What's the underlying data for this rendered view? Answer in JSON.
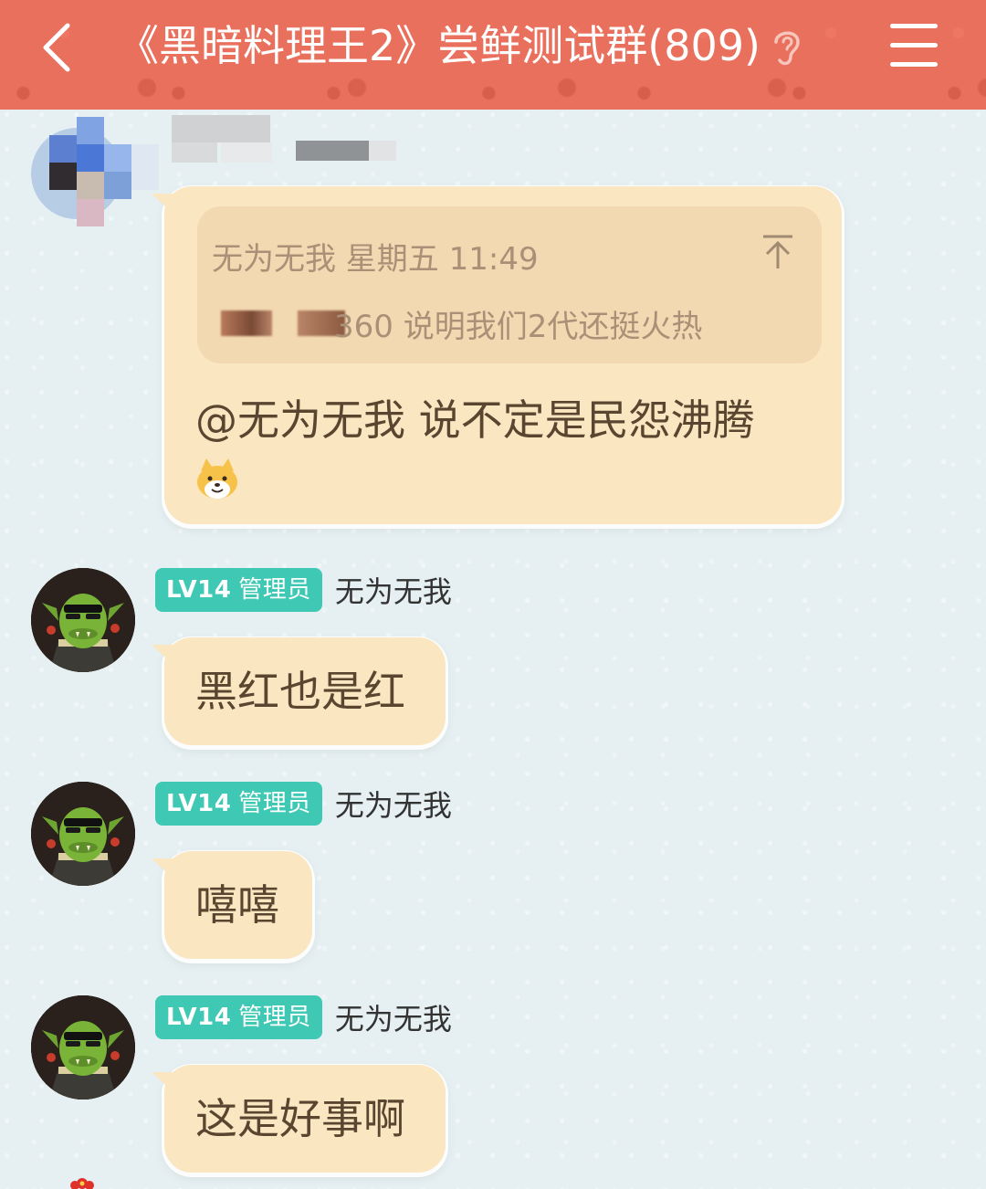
{
  "header": {
    "title": "《黑暗料理王2》尝鲜测试群(809)",
    "bg_color": "#e8705c"
  },
  "first_message": {
    "quote": {
      "author_time": "无为无我 星期五 11:49",
      "body": "360 说明我们2代还挺火热"
    },
    "text": "@无为无我 说不定是民怨沸腾"
  },
  "messages": [
    {
      "level": "LV14",
      "role": "管理员",
      "name": "无为无我",
      "text": "黑红也是红"
    },
    {
      "level": "LV14",
      "role": "管理员",
      "name": "无为无我",
      "text": "嘻嘻"
    },
    {
      "level": "LV14",
      "role": "管理员",
      "name": "无为无我",
      "text": "这是好事啊"
    }
  ],
  "colors": {
    "bubble": "#fbe6c2",
    "badge": "#3fc9b5",
    "background": "#e6f0f2"
  }
}
